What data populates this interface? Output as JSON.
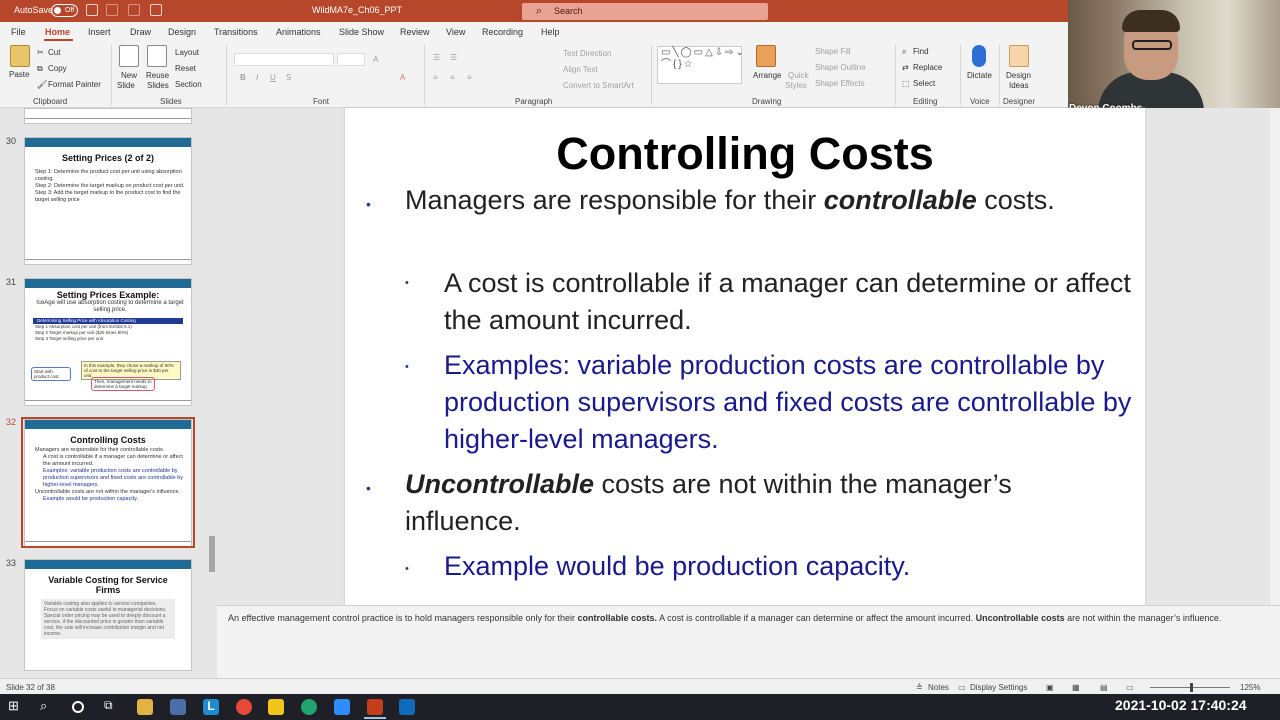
{
  "titlebar": {
    "autosave": "AutoSave",
    "toggle": "Off",
    "filename": "WildMA7e_Ch06_PPT",
    "search_placeholder": "Search"
  },
  "menu": [
    "File",
    "Home",
    "Insert",
    "Draw",
    "Design",
    "Transitions",
    "Animations",
    "Slide Show",
    "Review",
    "View",
    "Recording",
    "Help"
  ],
  "ribbon": {
    "paste": "Paste",
    "cut": "Cut",
    "copy": "Copy",
    "format_painter": "Format Painter",
    "clipboard": "Clipboard",
    "new_slide_1": "New",
    "new_slide_2": "Slide",
    "reuse_1": "Reuse",
    "reuse_2": "Slides",
    "layout": "Layout",
    "reset": "Reset",
    "section": "Section",
    "slides": "Slides",
    "font": "Font",
    "paragraph": "Paragraph",
    "text_direction": "Text Direction",
    "align_text": "Align Text",
    "convert_smartart": "Convert to SmartArt",
    "arrange": "Arrange",
    "quick_1": "Quick",
    "quick_2": "Styles",
    "shape_fill": "Shape Fill",
    "shape_outline": "Shape Outline",
    "shape_effects": "Shape Effects",
    "drawing": "Drawing",
    "find": "Find",
    "replace": "Replace",
    "select": "Select",
    "editing": "Editing",
    "dictate": "Dictate",
    "voice": "Voice",
    "design_ideas_1": "Design",
    "design_ideas_2": "Ideas",
    "designer": "Designer"
  },
  "webcam": {
    "name": "Devon Coombs"
  },
  "thumbnails": [
    {
      "num": "30",
      "title": "Setting Prices (2 of 2)",
      "lines": [
        "Step 1: Determine the product cost per unit using absorption costing.",
        "Step 2: Determine the target markup on product cost per unit.",
        "Step 3: Add the target markup to the product cost to find the target selling price"
      ]
    },
    {
      "num": "31",
      "title": "Setting Prices Example:",
      "subtitle": "IceAge will use absorption costing to determine a target selling price.",
      "table_header": "Determining Selling Price with Absorption Costing",
      "rows": [
        "Step 1  Absorption cost per unit (from Exhibit 6.1)",
        "Step 2  Target markup per unit ($25 times 60%)",
        "Step 3  Target selling price per unit"
      ],
      "note1": "In this example, they chose a markup of 60% of cost to the target selling price is $40 per unit.",
      "note2": "Start with product cost.",
      "note3": "Then, management needs to determine a target markup."
    },
    {
      "num": "32",
      "title": "Controlling Costs",
      "lines": [
        "Managers are responsible for their controllable costs.",
        "A cost is controllable if a manager can determine or affect the amount incurred.",
        "Examples: variable production costs are controllable by production supervisors and fixed costs are controllable by higher-level managers.",
        "Uncontrollable costs are not within the manager's influence.",
        "Example would be production capacity."
      ]
    },
    {
      "num": "33",
      "title": "Variable Costing for Service Firms",
      "lines": [
        "Variable costing also applies to service companies.",
        "Focus on variable costs useful in managerial decisions.",
        "Special order pricing may be used to deeply discount a service, if the discounted price is greater than variable cost, the sale will increase contribution margin and net income."
      ]
    }
  ],
  "slide": {
    "title": "Controlling Costs",
    "b1_pre": "Managers are responsible for their ",
    "b1_em": "controllable",
    "b1_post": " costs.",
    "b2": "A cost is controllable if a manager can determine or affect the amount incurred.",
    "b3": "Examples: variable production costs are controllable by production supervisors and fixed costs are controllable by higher-level managers.",
    "b4_em": "Uncontrollable",
    "b4_post": " costs are not within the manager’s influence.",
    "b5": "Example would be production capacity."
  },
  "notes": {
    "p1": "An effective management control practice is to hold managers responsible only for their ",
    "b1": "controllable costs.",
    "p2": " A cost is controllable if a manager can determine or affect the amount incurred. ",
    "b2": "Uncontrollable costs",
    "p3": " are not within the manager’s influence."
  },
  "status": {
    "slide": "Slide 32 of 38",
    "notes": "Notes",
    "display": "Display Settings",
    "zoom": "125%"
  },
  "taskbar": {
    "datetime": "2021-10-02 17:40:24"
  },
  "colors": {
    "accent": "#b7472a",
    "slide_blue": "#1a1a8c",
    "thumb_bar": "#1f6b96"
  }
}
